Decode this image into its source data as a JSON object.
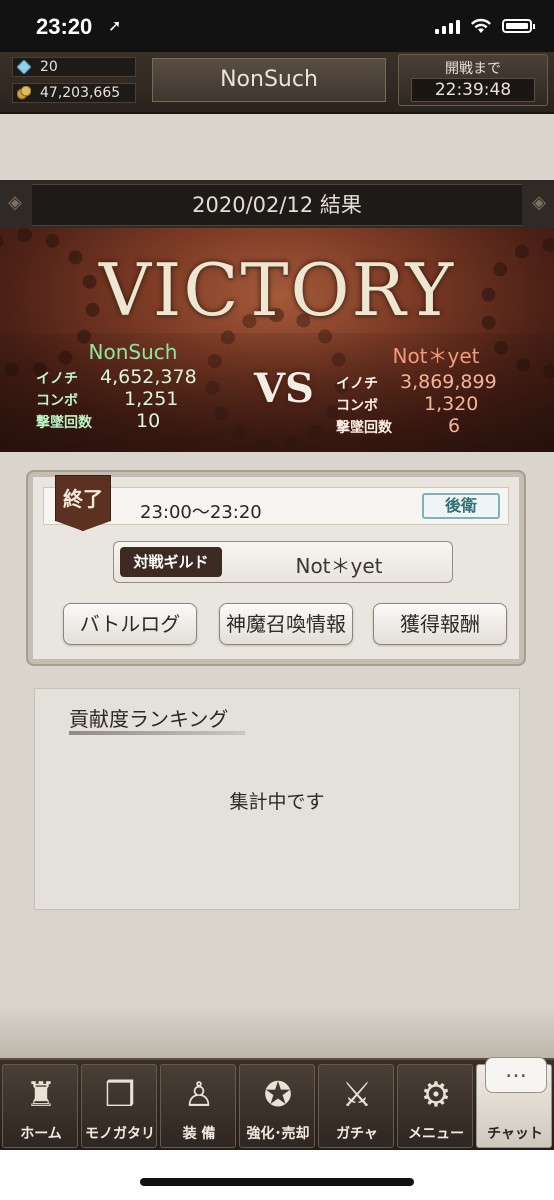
{
  "status_bar": {
    "time": "23:20"
  },
  "header": {
    "gems": "20",
    "coins": "47,203,665",
    "guild_name": "NonSuch",
    "timer_label": "開戦まで",
    "timer_value": "22:39:48"
  },
  "result": {
    "date_title": "2020/02/12 結果",
    "outcome": "VICTORY",
    "vs": "VS",
    "home": {
      "name": "NonSuch",
      "stats": [
        {
          "label": "イノチ",
          "value": "4,652,378"
        },
        {
          "label": "コンボ",
          "value": "1,251"
        },
        {
          "label": "撃墜回数",
          "value": "10"
        }
      ]
    },
    "away": {
      "name": "Not＊yet",
      "stats": [
        {
          "label": "イノチ",
          "value": "3,869,899"
        },
        {
          "label": "コンボ",
          "value": "1,320"
        },
        {
          "label": "撃墜回数",
          "value": "6"
        }
      ]
    }
  },
  "battle_info": {
    "status_tag": "終了",
    "time_range": "23:00〜23:20",
    "position_badge": "後衛",
    "opponent_label": "対戦ギルド",
    "opponent_name": "Not＊yet",
    "buttons": [
      "バトルログ",
      "神魔召喚情報",
      "獲得報酬"
    ]
  },
  "ranking": {
    "title": "貢献度ランキング",
    "status": "集計中です"
  },
  "nav": {
    "items": [
      {
        "label": "ホーム",
        "icon": "castle-icon"
      },
      {
        "label": "モノガタリ",
        "icon": "book-icon"
      },
      {
        "label": "装 備",
        "icon": "equipment-icon"
      },
      {
        "label": "強化･売却",
        "icon": "enhance-icon"
      },
      {
        "label": "ガチャ",
        "icon": "gacha-icon"
      },
      {
        "label": "メニュー",
        "icon": "gears-icon"
      },
      {
        "label": "チャット",
        "icon": "chat-icon"
      }
    ],
    "chat_bubble": "…"
  },
  "colors": {
    "victory_green": "#8fe6a2",
    "defeat_red": "#f29a7b",
    "panel_bg": "#e9e5df",
    "header_dark": "#2a231d"
  }
}
